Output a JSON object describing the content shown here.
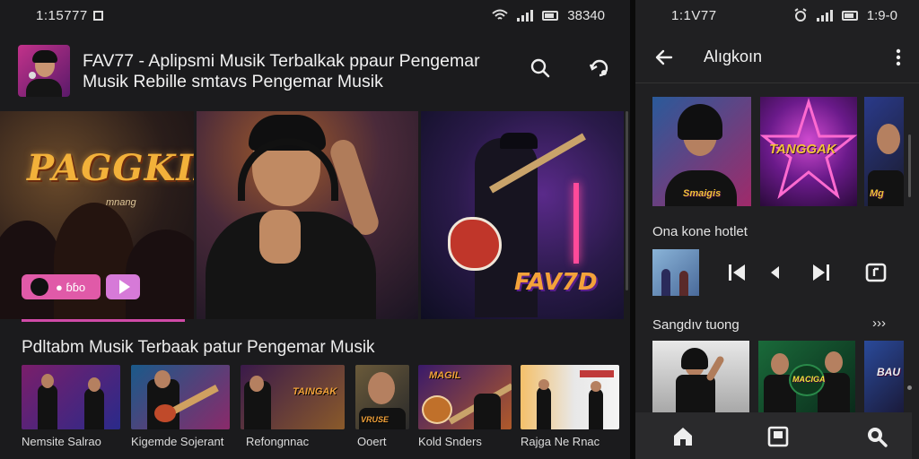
{
  "left": {
    "status": {
      "time": "1:15777",
      "signal_text": "38340"
    },
    "header": {
      "title_line1": "FAV77 - Aplipsmi Musik Terbalkak ppaur Pengemar",
      "title_line2": "Musik Rebille smtavs Pengemar Musik",
      "search_icon": "search-icon",
      "share_icon": "share-icon"
    },
    "banners": {
      "b1_title": "PAGGKIN",
      "b1_sub": "mnanɡ",
      "b1_button": "● ɓɓo",
      "b3_logo": "FAV7D"
    },
    "section_title": "Pdltabm Musik Terbaak patur Pengemar Musik",
    "cards": [
      {
        "label": "Nemsite Salrao",
        "art_text": ""
      },
      {
        "label": "Kigemde Sojerant",
        "art_text": ""
      },
      {
        "label": "Refongnnac",
        "art_text": "TAINGAK"
      },
      {
        "label": "Ooert",
        "art_text": "VRUSE"
      },
      {
        "label": "Kold Snders",
        "art_text": "MAGIL"
      },
      {
        "label": "Rajga Ne Rnac",
        "art_text": ""
      }
    ]
  },
  "right": {
    "status": {
      "time": "1:1V77",
      "signal_text": "1:9-0"
    },
    "appbar_title": "Alıgkoın",
    "albums": [
      {
        "text": "Smaigis"
      },
      {
        "text": "TANGGAK"
      },
      {
        "text": "Mg"
      }
    ],
    "now_label": "Ona kone hotlet",
    "section2_label": "Sangdıv tuong",
    "section2_arrow": "›››",
    "cards2": [
      {
        "text": ""
      },
      {
        "text": "MACIGA"
      },
      {
        "text": "BAU"
      }
    ]
  },
  "colors": {
    "accent": "#d04aa8",
    "background": "#1b1b1d",
    "panel_right": "#202022",
    "bottom_nav": "#2a2a2c"
  }
}
